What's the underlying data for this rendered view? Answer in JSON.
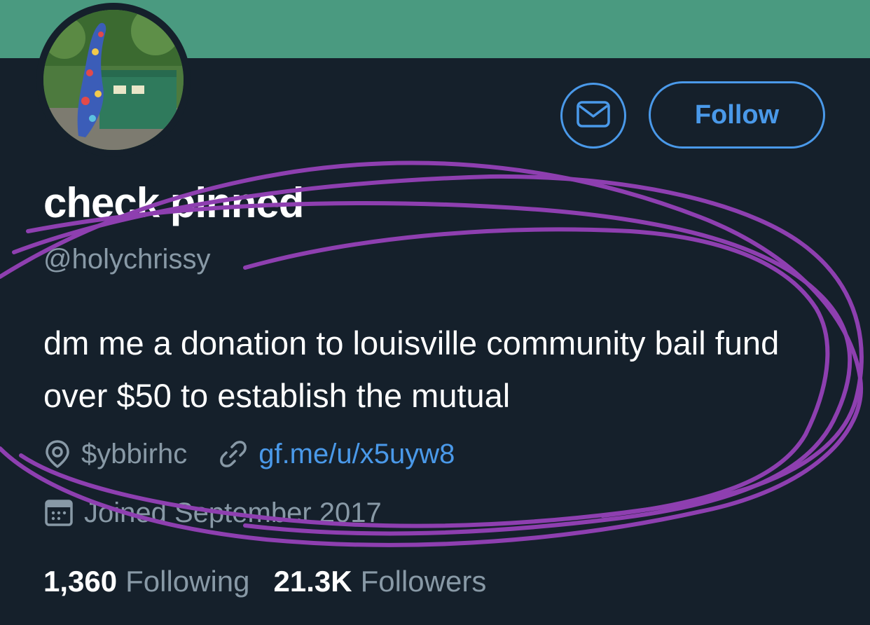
{
  "profile": {
    "display_name": "check pinned",
    "handle": "@holychrissy",
    "bio": "dm me a donation to louisville community bail fund over $50 to establish the mutual",
    "location": "$ybbirhc",
    "website": "gf.me/u/x5uyw8",
    "joined": "Joined September 2017"
  },
  "actions": {
    "follow_label": "Follow",
    "message_icon": "envelope-icon"
  },
  "stats": {
    "following_count": "1,360",
    "following_label": "Following",
    "followers_count": "21.3K",
    "followers_label": "Followers"
  },
  "colors": {
    "banner": "#4a9a80",
    "background": "#15202b",
    "accent": "#4a99e9",
    "muted_text": "#8899a6",
    "scribble": "#8e3fb0"
  },
  "icons": {
    "location": "location-pin-icon",
    "link": "link-icon",
    "calendar": "calendar-icon"
  }
}
